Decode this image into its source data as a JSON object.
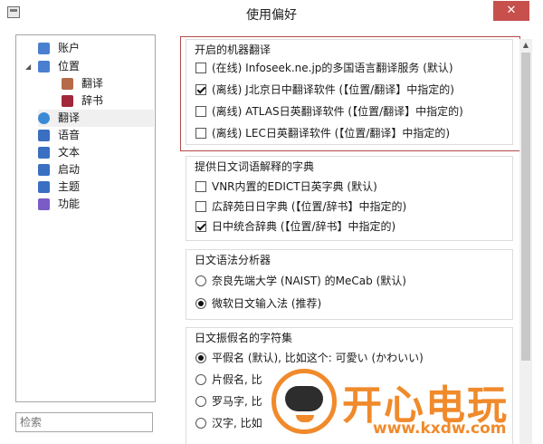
{
  "window": {
    "title": "使用偏好",
    "close_label": "✕"
  },
  "sidebar": {
    "items": [
      {
        "label": "账户",
        "icon": "user-icon",
        "color": "#4a7fd0"
      },
      {
        "label": "位置",
        "icon": "user-icon",
        "color": "#4a7fd0"
      },
      {
        "label": "翻译",
        "icon": "translate-book-icon",
        "color": "#b56a4a"
      },
      {
        "label": "辞书",
        "icon": "dictionary-icon",
        "color": "#a0283a"
      },
      {
        "label": "翻译",
        "icon": "globe-icon",
        "color": "#3b8ad6"
      },
      {
        "label": "语音",
        "icon": "music-note-icon",
        "color": "#3b6fc2"
      },
      {
        "label": "文本",
        "icon": "text-icon",
        "color": "#3b6fc2"
      },
      {
        "label": "启动",
        "icon": "launch-icon",
        "color": "#3b6fc2"
      },
      {
        "label": "主题",
        "icon": "theme-icon",
        "color": "#3b6fc2"
      },
      {
        "label": "功能",
        "icon": "gear-icon",
        "color": "#7b5cc7"
      }
    ],
    "search_placeholder": "检索"
  },
  "groups": {
    "machine_translation": {
      "title": "开启的机器翻译",
      "options": [
        {
          "label": "(在线) Infoseek.ne.jp的多国语言翻译服务 (默认)",
          "checked": false
        },
        {
          "label": "(离线) J北京日中翻译软件 (【位置/翻译】中指定的)",
          "checked": true
        },
        {
          "label": "(离线) ATLAS日英翻译软件 (【位置/翻译】中指定的)",
          "checked": false
        },
        {
          "label": "(离线) LEC日英翻译软件 (【位置/翻译】中指定的)",
          "checked": false
        }
      ]
    },
    "dictionaries": {
      "title": "提供日文词语解释的字典",
      "options": [
        {
          "label": "VNR内置的EDICT日英字典 (默认)",
          "checked": false
        },
        {
          "label": "広辞苑日日字典 (【位置/辞书】中指定的)",
          "checked": false
        },
        {
          "label": "日中统合辞典 (【位置/辞书】中指定的)",
          "checked": true
        }
      ]
    },
    "grammar": {
      "title": "日文语法分析器",
      "options": [
        {
          "label": "奈良先端大学 (NAIST) 的MeCab (默认)",
          "checked": false
        },
        {
          "label": "微软日文输入法 (推荐)",
          "checked": true
        }
      ]
    },
    "kana": {
      "title": "日文振假名的字符集",
      "options": [
        {
          "label": "平假名 (默认), 比如这个: 可愛い (かわいい)",
          "checked": true
        },
        {
          "label": "片假名, 比",
          "checked": false
        },
        {
          "label": "罗马字, 比",
          "checked": false
        },
        {
          "label": "汉字, 比如",
          "checked": false
        }
      ]
    }
  },
  "watermark": {
    "text": "开心电玩",
    "url": "www.kxdw.com"
  }
}
